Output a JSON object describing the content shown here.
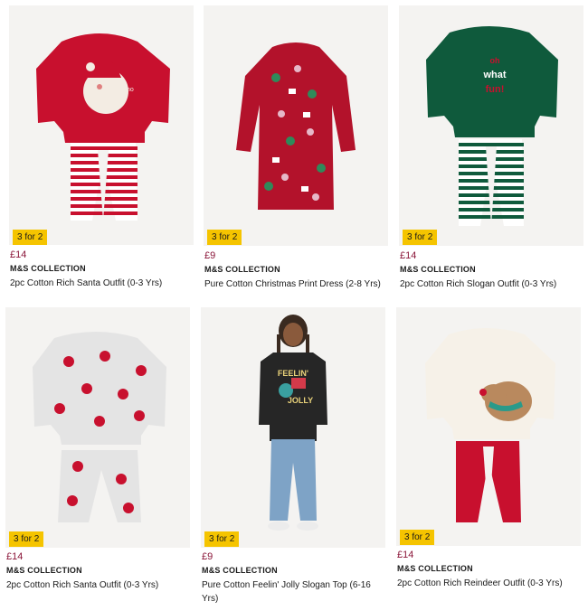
{
  "products": [
    {
      "badge": "3 for 2",
      "price": "£14",
      "brand": "M&S COLLECTION",
      "title": "2pc Cotton Rich Santa Outfit (0-3 Yrs)"
    },
    {
      "badge": "3 for 2",
      "price": "£9",
      "brand": "M&S COLLECTION",
      "title": "Pure Cotton Christmas Print Dress (2-8 Yrs)"
    },
    {
      "badge": "3 for 2",
      "price": "£14",
      "brand": "M&S COLLECTION",
      "title": "2pc Cotton Rich Slogan Outfit (0-3 Yrs)"
    },
    {
      "badge": "3 for 2",
      "price": "£14",
      "brand": "M&S COLLECTION",
      "title": "2pc Cotton Rich Santa Outfit (0-3 Yrs)"
    },
    {
      "badge": "3 for 2",
      "price": "£9",
      "brand": "M&S COLLECTION",
      "title": "Pure Cotton Feelin' Jolly Slogan Top (6-16 Yrs)"
    },
    {
      "badge": "3 for 2",
      "price": "£14",
      "brand": "M&S COLLECTION",
      "title": "2pc Cotton Rich Reindeer Outfit (0-3 Yrs)"
    }
  ],
  "artwork": {
    "slogan_text": "oh what fun!",
    "jolly_text_1": "FEELIN'",
    "jolly_text_2": "JOLLY"
  },
  "colors": {
    "badge": "#f5c400",
    "price": "#8a1538",
    "red": "#c8102e",
    "green": "#0f5a3c"
  }
}
